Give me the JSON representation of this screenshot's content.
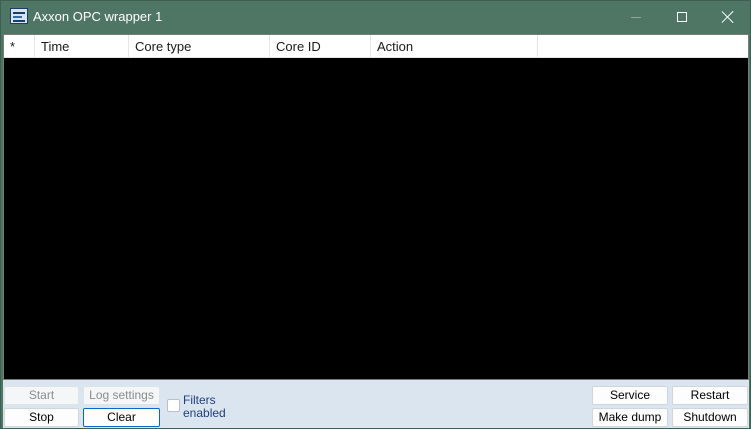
{
  "window": {
    "title": "Axxon OPC wrapper 1",
    "icon": "app-log-icon"
  },
  "listview": {
    "columns": [
      "*",
      "Time",
      "Core type",
      "Core ID",
      "Action",
      ""
    ],
    "rows": []
  },
  "toolbar": {
    "start_label": "Start",
    "stop_label": "Stop",
    "log_settings_label": "Log settings",
    "clear_label": "Clear",
    "filters_label": "Filters enabled",
    "filters_checked": false,
    "service_label": "Service",
    "make_dump_label": "Make dump",
    "restart_label": "Restart",
    "shutdown_label": "Shutdown"
  },
  "colors": {
    "titlebar": "#4f7565",
    "client": "#dbe5ef",
    "list_background": "#000000",
    "focus_border": "#0a67c9"
  }
}
